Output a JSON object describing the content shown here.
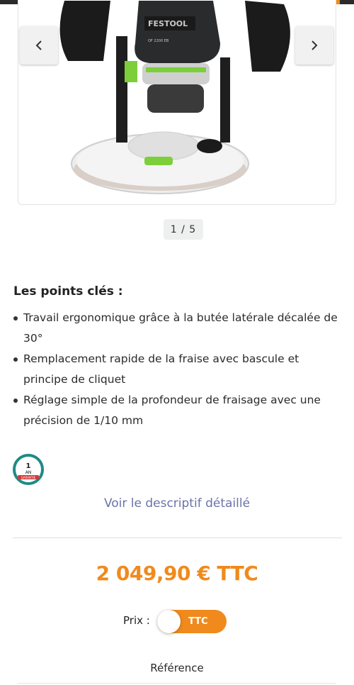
{
  "gallery": {
    "brand_on_tool": "FESTOOL",
    "model_on_tool": "OF 2200 EB",
    "pager": "1 / 5",
    "prev_icon": "chevron-left-icon",
    "next_icon": "chevron-right-icon"
  },
  "key_points": {
    "title": "Les points clés :",
    "items": [
      "Travail ergonomique grâce à la butée latérale décalée de 30°",
      "Remplacement rapide de la fraise avec bascule et principe de cliquet",
      "Réglage simple de la profondeur de fraisage avec une précision de 1/10 mm"
    ]
  },
  "warranty": {
    "years": "1",
    "unit": "AN",
    "label": "GARANTIE"
  },
  "detail_link": "Voir le descriptif détaillé",
  "price": {
    "amount": "2 049,90 € TTC",
    "mode_label": "Prix :",
    "toggle_label": "TTC"
  },
  "reference_label": "Référence",
  "colors": {
    "accent": "#f08a1c",
    "link": "#6b73a8",
    "tool_green": "#7ccf3a"
  }
}
